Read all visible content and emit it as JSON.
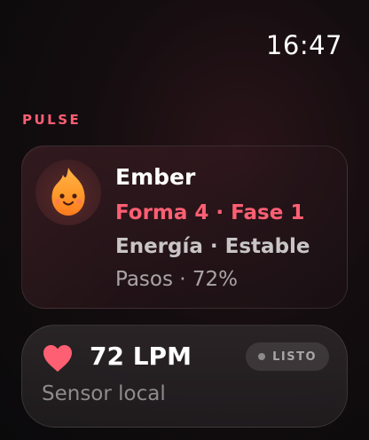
{
  "status_bar": {
    "time": "16:47"
  },
  "section": {
    "title": "PULSE"
  },
  "pet": {
    "avatar_icon": "fire-mascot-icon",
    "name": "Ember",
    "stage": "Forma 4 · Fase 1",
    "energy": "Energía · Estable",
    "steps": "Pasos · 72%"
  },
  "heart_rate": {
    "icon": "heart-icon",
    "value": "72 LPM",
    "status": "LISTO",
    "source": "Sensor local"
  },
  "colors": {
    "accent": "#ff5f73",
    "heart": "#ff5f73"
  }
}
